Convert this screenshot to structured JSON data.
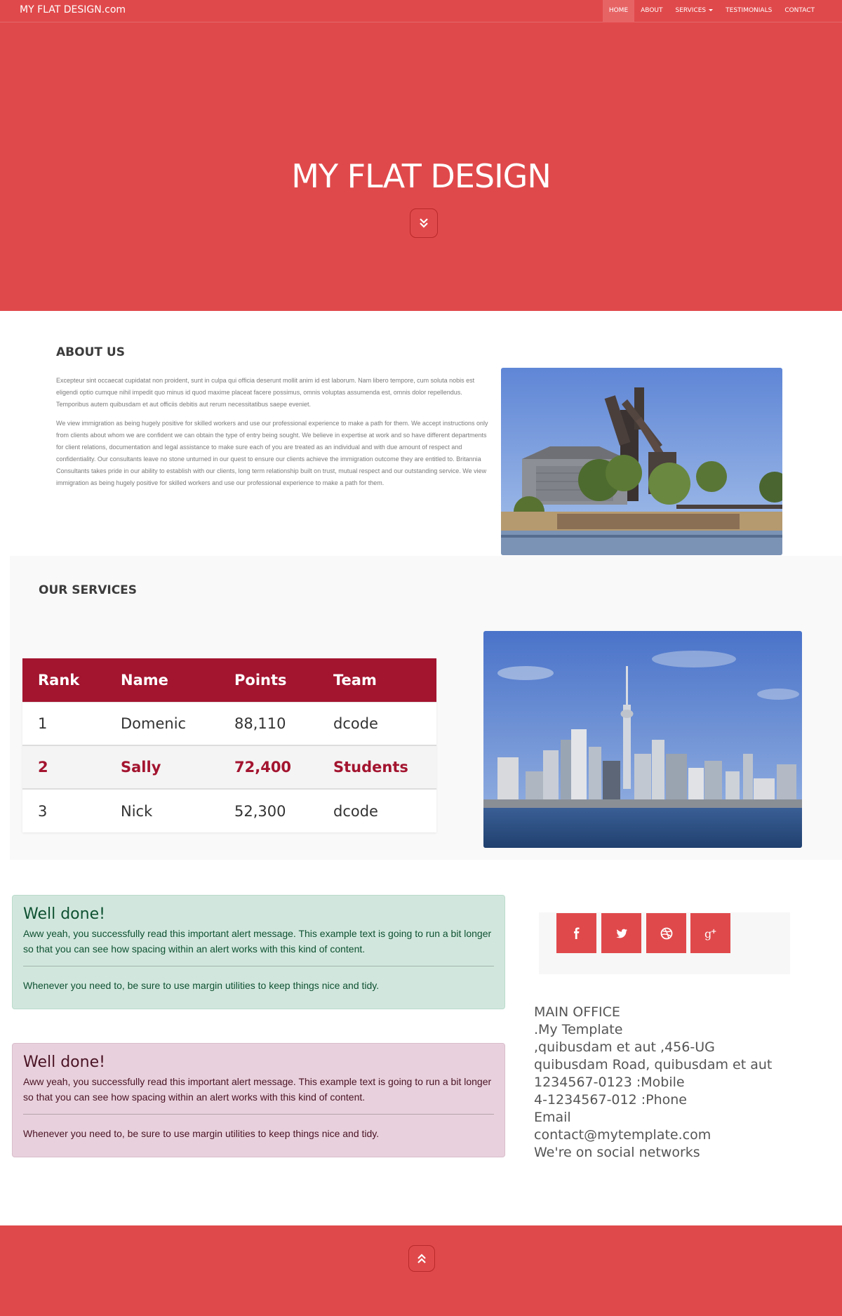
{
  "nav": {
    "brand": "MY FLAT DESIGN.com",
    "items": [
      {
        "label": "HOME",
        "active": true
      },
      {
        "label": "ABOUT",
        "active": false
      },
      {
        "label": "SERVICES",
        "active": false,
        "dropdown": true
      },
      {
        "label": "TESTIMONIALS",
        "active": false
      },
      {
        "label": "CONTACT",
        "active": false
      }
    ]
  },
  "hero": {
    "title": "MY FLAT DESIGN",
    "scroll_icon": "double-chevron-down-icon"
  },
  "about": {
    "title": "ABOUT US",
    "paragraph1": "Excepteur sint occaecat cupidatat non proident, sunt in culpa qui officia deserunt mollit anim id est laborum. Nam libero tempore, cum soluta nobis est eligendi optio cumque nihil impedit quo minus id quod maxime placeat facere possimus, omnis voluptas assumenda est, omnis dolor repellendus. Temporibus autem quibusdam et aut officiis debitis aut rerum necessitatibus saepe eveniet.",
    "paragraph2": "We view immigration as being hugely positive for skilled workers and use our professional experience to make a path for them. We accept instructions only from clients about whom we are confident we can obtain the type of entry being sought. We believe in expertise at work and so have different departments for client relations, documentation and legal assistance to make sure each of you are treated as an individual and with due amount of respect and confidentiality. Our consultants leave no stone unturned in our quest to ensure our clients achieve the immigration outcome they are entitled to. Britannia Consultants takes pride in our ability to establish with our clients, long term relationship built on trust, mutual respect and our outstanding service. We view immigration as being hugely positive for skilled workers and use our professional experience to make a path for them."
  },
  "services": {
    "title": "OUR SERVICES",
    "table": {
      "headers": [
        "Rank",
        "Name",
        "Points",
        "Team"
      ],
      "rows": [
        [
          "1",
          "Domenic",
          "88,110",
          "dcode"
        ],
        [
          "2",
          "Sally",
          "72,400",
          "Students"
        ],
        [
          "3",
          "Nick",
          "52,300",
          "dcode"
        ]
      ],
      "highlighted_row": 1
    }
  },
  "alerts": [
    {
      "type": "success",
      "heading": "Well done!",
      "text": "Aww yeah, you successfully read this important alert message. This example text is going to run a bit longer so that you can see how spacing within an alert works with this kind of content.",
      "footer": "Whenever you need to, be sure to use margin utilities to keep things nice and tidy."
    },
    {
      "type": "danger",
      "heading": "Well done!",
      "text": "Aww yeah, you successfully read this important alert message. This example text is going to run a bit longer so that you can see how spacing within an alert works with this kind of content.",
      "footer": "Whenever you need to, be sure to use margin utilities to keep things nice and tidy."
    }
  ],
  "social": [
    "facebook-icon",
    "twitter-icon",
    "dribbble-icon",
    "google-plus-icon"
  ],
  "contact": {
    "lines": [
      "MAIN OFFICE",
      ".My Template",
      ",quibusdam et aut ,456-UG",
      "quibusdam Road, quibusdam et aut",
      "1234567-0123 :Mobile",
      "4-1234567-012 :Phone",
      "Email",
      "contact@mytemplate.com",
      "We're on social networks"
    ]
  },
  "footer": {
    "scroll_icon": "double-chevron-up-icon"
  },
  "colors": {
    "brand_red": "#e0494b",
    "table_header": "#a3142f",
    "success_bg": "#d1e7dd",
    "danger_bg": "#e8d1dc"
  }
}
